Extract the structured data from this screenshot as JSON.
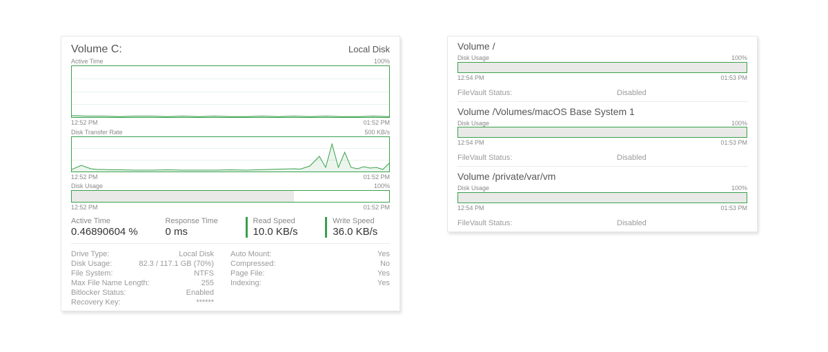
{
  "left": {
    "title": "Volume C:",
    "subtitle": "Local Disk",
    "chart1": {
      "title": "Active Time",
      "max": "100%",
      "start": "12:52 PM",
      "end": "01:52 PM"
    },
    "chart2": {
      "title": "Disk Transfer Rate",
      "max": "500 KB/s",
      "start": "12:52 PM",
      "end": "01:52 PM"
    },
    "chart3": {
      "title": "Disk Usage",
      "max": "100%",
      "start": "12:52 PM",
      "end": "01:52 PM"
    },
    "stats": {
      "s1_label": "Active Time",
      "s1_value": "0.46890604 %",
      "s2_label": "Response Time",
      "s2_value": "0 ms",
      "s3_label": "Read Speed",
      "s3_value": "10.0 KB/s",
      "s4_label": "Write Speed",
      "s4_value": "36.0 KB/s"
    },
    "details1": [
      {
        "k": "Drive Type:",
        "v": "Local Disk"
      },
      {
        "k": "Disk Usage:",
        "v": "82.3 / 117.1 GB (70%)"
      },
      {
        "k": "File System:",
        "v": "NTFS"
      },
      {
        "k": "Max File Name Length:",
        "v": "255"
      },
      {
        "k": "Bitlocker Status:",
        "v": "Enabled"
      },
      {
        "k": "Recovery Key:",
        "v": "******"
      }
    ],
    "details2": [
      {
        "k": "Auto Mount:",
        "v": "Yes"
      },
      {
        "k": "Compressed:",
        "v": "No"
      },
      {
        "k": "Page File:",
        "v": "Yes"
      },
      {
        "k": "Indexing:",
        "v": "Yes"
      }
    ]
  },
  "right": {
    "entries": [
      {
        "title": "Volume /",
        "du_label": "Disk Usage",
        "max": "100%",
        "start": "12:54 PM",
        "end": "01:53 PM",
        "fv_k": "FileVault Status:",
        "fv_v": "Disabled"
      },
      {
        "title": "Volume /Volumes/macOS Base System 1",
        "du_label": "Disk Usage",
        "max": "100%",
        "start": "12:54 PM",
        "end": "01:53 PM",
        "fv_k": "FileVault Status:",
        "fv_v": "Disabled"
      },
      {
        "title": "Volume /private/var/vm",
        "du_label": "Disk Usage",
        "max": "100%",
        "start": "12:54 PM",
        "end": "01:53 PM",
        "fv_k": "FileVault Status:",
        "fv_v": "Disabled"
      }
    ]
  },
  "chart_data": [
    {
      "type": "line",
      "title": "Active Time",
      "ylabel": "%",
      "ylim": [
        0,
        100
      ],
      "x_start": "12:52 PM",
      "x_end": "01:52 PM",
      "series": [
        {
          "name": "active_time",
          "x_pct": [
            0,
            5,
            10,
            15,
            20,
            25,
            30,
            35,
            40,
            45,
            50,
            55,
            60,
            65,
            70,
            75,
            80,
            85,
            90,
            95,
            100
          ],
          "values": [
            3,
            2,
            2,
            1,
            2,
            2,
            1,
            2,
            1,
            2,
            1,
            1,
            2,
            1,
            2,
            1,
            2,
            1,
            1,
            2,
            1
          ]
        }
      ]
    },
    {
      "type": "line",
      "title": "Disk Transfer Rate",
      "ylabel": "KB/s",
      "ylim": [
        0,
        500
      ],
      "x_start": "12:52 PM",
      "x_end": "01:52 PM",
      "series": [
        {
          "name": "transfer_rate",
          "x_pct": [
            0,
            3,
            6,
            8,
            10,
            12,
            15,
            20,
            25,
            30,
            35,
            40,
            45,
            50,
            55,
            58,
            62,
            66,
            70,
            72,
            75,
            78,
            80,
            82,
            84,
            86,
            88,
            90,
            92,
            94,
            96,
            98,
            100
          ],
          "values": [
            30,
            90,
            40,
            30,
            30,
            25,
            25,
            20,
            20,
            25,
            20,
            20,
            20,
            25,
            20,
            25,
            30,
            35,
            40,
            35,
            80,
            220,
            60,
            400,
            60,
            280,
            60,
            40,
            70,
            50,
            60,
            30,
            120
          ]
        }
      ]
    },
    {
      "type": "bar",
      "title": "Disk Usage (Volume C:)",
      "ylim": [
        0,
        100
      ],
      "value_pct": 70
    },
    {
      "type": "bar",
      "title": "Disk Usage (Volume /)",
      "ylim": [
        0,
        100
      ],
      "value_pct": 100
    },
    {
      "type": "bar",
      "title": "Disk Usage (/Volumes/macOS Base System 1)",
      "ylim": [
        0,
        100
      ],
      "value_pct": 100
    },
    {
      "type": "bar",
      "title": "Disk Usage (/private/var/vm)",
      "ylim": [
        0,
        100
      ],
      "value_pct": 100
    }
  ]
}
